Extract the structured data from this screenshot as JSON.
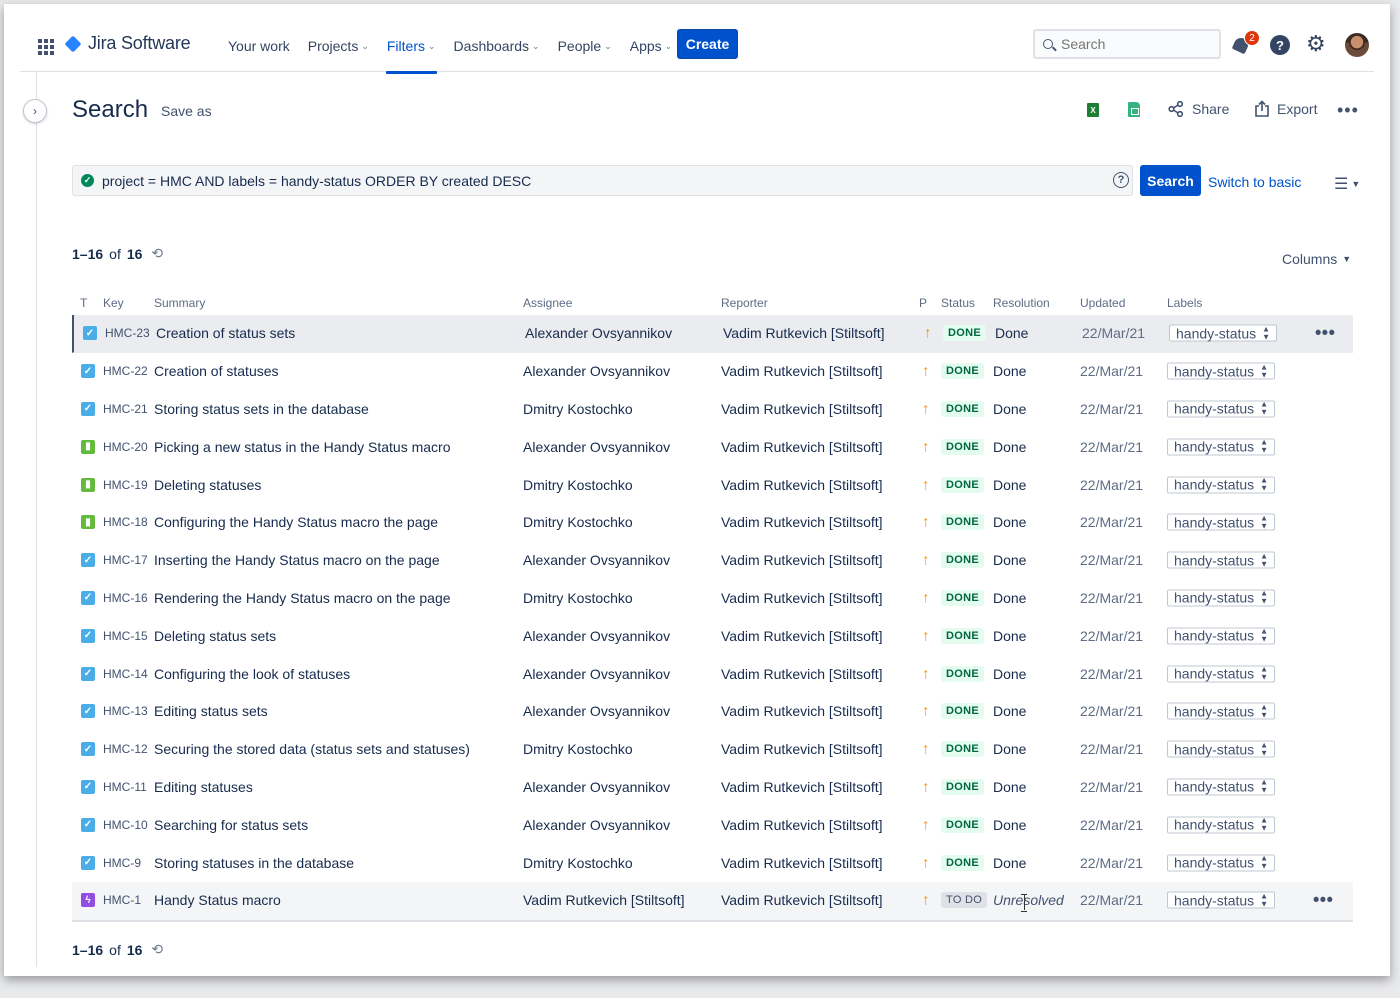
{
  "nav": {
    "brand": "Jira Software",
    "items": [
      {
        "label": "Your work",
        "dropdown": false,
        "active": false
      },
      {
        "label": "Projects",
        "dropdown": true,
        "active": false
      },
      {
        "label": "Filters",
        "dropdown": true,
        "active": true
      },
      {
        "label": "Dashboards",
        "dropdown": true,
        "active": false
      },
      {
        "label": "People",
        "dropdown": true,
        "active": false
      },
      {
        "label": "Apps",
        "dropdown": true,
        "active": false
      }
    ],
    "create_label": "Create",
    "search_placeholder": "Search",
    "notification_count": "2",
    "accent": "#0052cc"
  },
  "header": {
    "title": "Search",
    "save_as": "Save as",
    "share": "Share",
    "export": "Export"
  },
  "jql": {
    "query": "project = HMC AND labels = handy-status ORDER BY created DESC",
    "search_label": "Search",
    "switch_label": "Switch to basic"
  },
  "results": {
    "range": "1–16",
    "of": "of",
    "total": "16",
    "columns_label": "Columns"
  },
  "table": {
    "headers": {
      "type": "T",
      "key": "Key",
      "summary": "Summary",
      "assignee": "Assignee",
      "reporter": "Reporter",
      "priority": "P",
      "status": "Status",
      "resolution": "Resolution",
      "updated": "Updated",
      "labels": "Labels"
    },
    "rows": [
      {
        "type": "task",
        "key": "HMC-23",
        "summary": "Creation of status sets",
        "assignee": "Alexander Ovsyannikov",
        "reporter": "Vadim Rutkevich [Stiltsoft]",
        "status": "DONE",
        "resolution": "Done",
        "updated": "22/Mar/21",
        "label": "handy-status"
      },
      {
        "type": "task",
        "key": "HMC-22",
        "summary": "Creation of statuses",
        "assignee": "Alexander Ovsyannikov",
        "reporter": "Vadim Rutkevich [Stiltsoft]",
        "status": "DONE",
        "resolution": "Done",
        "updated": "22/Mar/21",
        "label": "handy-status"
      },
      {
        "type": "task",
        "key": "HMC-21",
        "summary": "Storing status sets in the database",
        "assignee": "Dmitry Kostochko",
        "reporter": "Vadim Rutkevich [Stiltsoft]",
        "status": "DONE",
        "resolution": "Done",
        "updated": "22/Mar/21",
        "label": "handy-status"
      },
      {
        "type": "story",
        "key": "HMC-20",
        "summary": "Picking a new status in the Handy Status macro",
        "assignee": "Alexander Ovsyannikov",
        "reporter": "Vadim Rutkevich [Stiltsoft]",
        "status": "DONE",
        "resolution": "Done",
        "updated": "22/Mar/21",
        "label": "handy-status"
      },
      {
        "type": "story",
        "key": "HMC-19",
        "summary": "Deleting statuses",
        "assignee": "Dmitry Kostochko",
        "reporter": "Vadim Rutkevich [Stiltsoft]",
        "status": "DONE",
        "resolution": "Done",
        "updated": "22/Mar/21",
        "label": "handy-status"
      },
      {
        "type": "story",
        "key": "HMC-18",
        "summary": "Configuring the Handy Status macro the page",
        "assignee": "Dmitry Kostochko",
        "reporter": "Vadim Rutkevich [Stiltsoft]",
        "status": "DONE",
        "resolution": "Done",
        "updated": "22/Mar/21",
        "label": "handy-status"
      },
      {
        "type": "task",
        "key": "HMC-17",
        "summary": "Inserting the Handy Status macro on the page",
        "assignee": "Alexander Ovsyannikov",
        "reporter": "Vadim Rutkevich [Stiltsoft]",
        "status": "DONE",
        "resolution": "Done",
        "updated": "22/Mar/21",
        "label": "handy-status"
      },
      {
        "type": "task",
        "key": "HMC-16",
        "summary": "Rendering the Handy Status macro on the page",
        "assignee": "Dmitry Kostochko",
        "reporter": "Vadim Rutkevich [Stiltsoft]",
        "status": "DONE",
        "resolution": "Done",
        "updated": "22/Mar/21",
        "label": "handy-status"
      },
      {
        "type": "task",
        "key": "HMC-15",
        "summary": "Deleting status sets",
        "assignee": "Alexander Ovsyannikov",
        "reporter": "Vadim Rutkevich [Stiltsoft]",
        "status": "DONE",
        "resolution": "Done",
        "updated": "22/Mar/21",
        "label": "handy-status"
      },
      {
        "type": "task",
        "key": "HMC-14",
        "summary": "Configuring the look of statuses",
        "assignee": "Alexander Ovsyannikov",
        "reporter": "Vadim Rutkevich [Stiltsoft]",
        "status": "DONE",
        "resolution": "Done",
        "updated": "22/Mar/21",
        "label": "handy-status"
      },
      {
        "type": "task",
        "key": "HMC-13",
        "summary": "Editing status sets",
        "assignee": "Alexander Ovsyannikov",
        "reporter": "Vadim Rutkevich [Stiltsoft]",
        "status": "DONE",
        "resolution": "Done",
        "updated": "22/Mar/21",
        "label": "handy-status"
      },
      {
        "type": "task",
        "key": "HMC-12",
        "summary": "Securing the stored data (status sets and statuses)",
        "assignee": "Dmitry Kostochko",
        "reporter": "Vadim Rutkevich [Stiltsoft]",
        "status": "DONE",
        "resolution": "Done",
        "updated": "22/Mar/21",
        "label": "handy-status"
      },
      {
        "type": "task",
        "key": "HMC-11",
        "summary": "Editing statuses",
        "assignee": "Alexander Ovsyannikov",
        "reporter": "Vadim Rutkevich [Stiltsoft]",
        "status": "DONE",
        "resolution": "Done",
        "updated": "22/Mar/21",
        "label": "handy-status"
      },
      {
        "type": "task",
        "key": "HMC-10",
        "summary": "Searching for status sets",
        "assignee": "Alexander Ovsyannikov",
        "reporter": "Vadim Rutkevich [Stiltsoft]",
        "status": "DONE",
        "resolution": "Done",
        "updated": "22/Mar/21",
        "label": "handy-status"
      },
      {
        "type": "task",
        "key": "HMC-9",
        "summary": "Storing statuses in the database",
        "assignee": "Dmitry Kostochko",
        "reporter": "Vadim Rutkevich [Stiltsoft]",
        "status": "DONE",
        "resolution": "Done",
        "updated": "22/Mar/21",
        "label": "handy-status"
      },
      {
        "type": "epic",
        "key": "HMC-1",
        "summary": "Handy Status macro",
        "assignee": "Vadim Rutkevich [Stiltsoft]",
        "reporter": "Vadim Rutkevich [Stiltsoft]",
        "status": "TO DO",
        "resolution": "Unresolved",
        "updated": "22/Mar/21",
        "label": "handy-status"
      }
    ]
  }
}
